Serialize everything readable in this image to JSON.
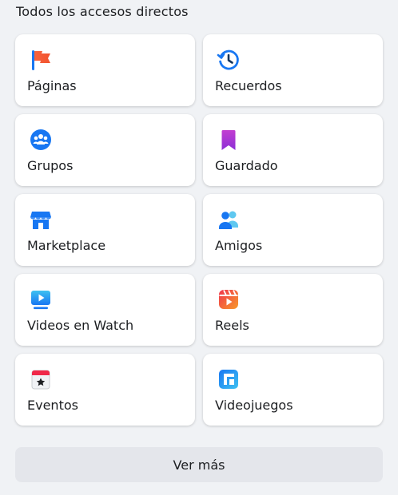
{
  "section_title": "Todos los accesos directos",
  "shortcuts": [
    {
      "label": "Páginas",
      "icon": "flag-icon"
    },
    {
      "label": "Recuerdos",
      "icon": "clock-history-icon"
    },
    {
      "label": "Grupos",
      "icon": "groups-icon"
    },
    {
      "label": "Guardado",
      "icon": "bookmark-icon"
    },
    {
      "label": "Marketplace",
      "icon": "shop-icon"
    },
    {
      "label": "Amigos",
      "icon": "friends-icon"
    },
    {
      "label": "Videos en Watch",
      "icon": "watch-video-icon"
    },
    {
      "label": "Reels",
      "icon": "reels-icon"
    },
    {
      "label": "Eventos",
      "icon": "calendar-star-icon"
    },
    {
      "label": "Videojuegos",
      "icon": "gaming-icon"
    }
  ],
  "see_more_label": "Ver más",
  "colors": {
    "background": "#f0f2f5",
    "card": "#ffffff",
    "button": "#e4e6eb",
    "brand_blue": "#1877f2"
  }
}
